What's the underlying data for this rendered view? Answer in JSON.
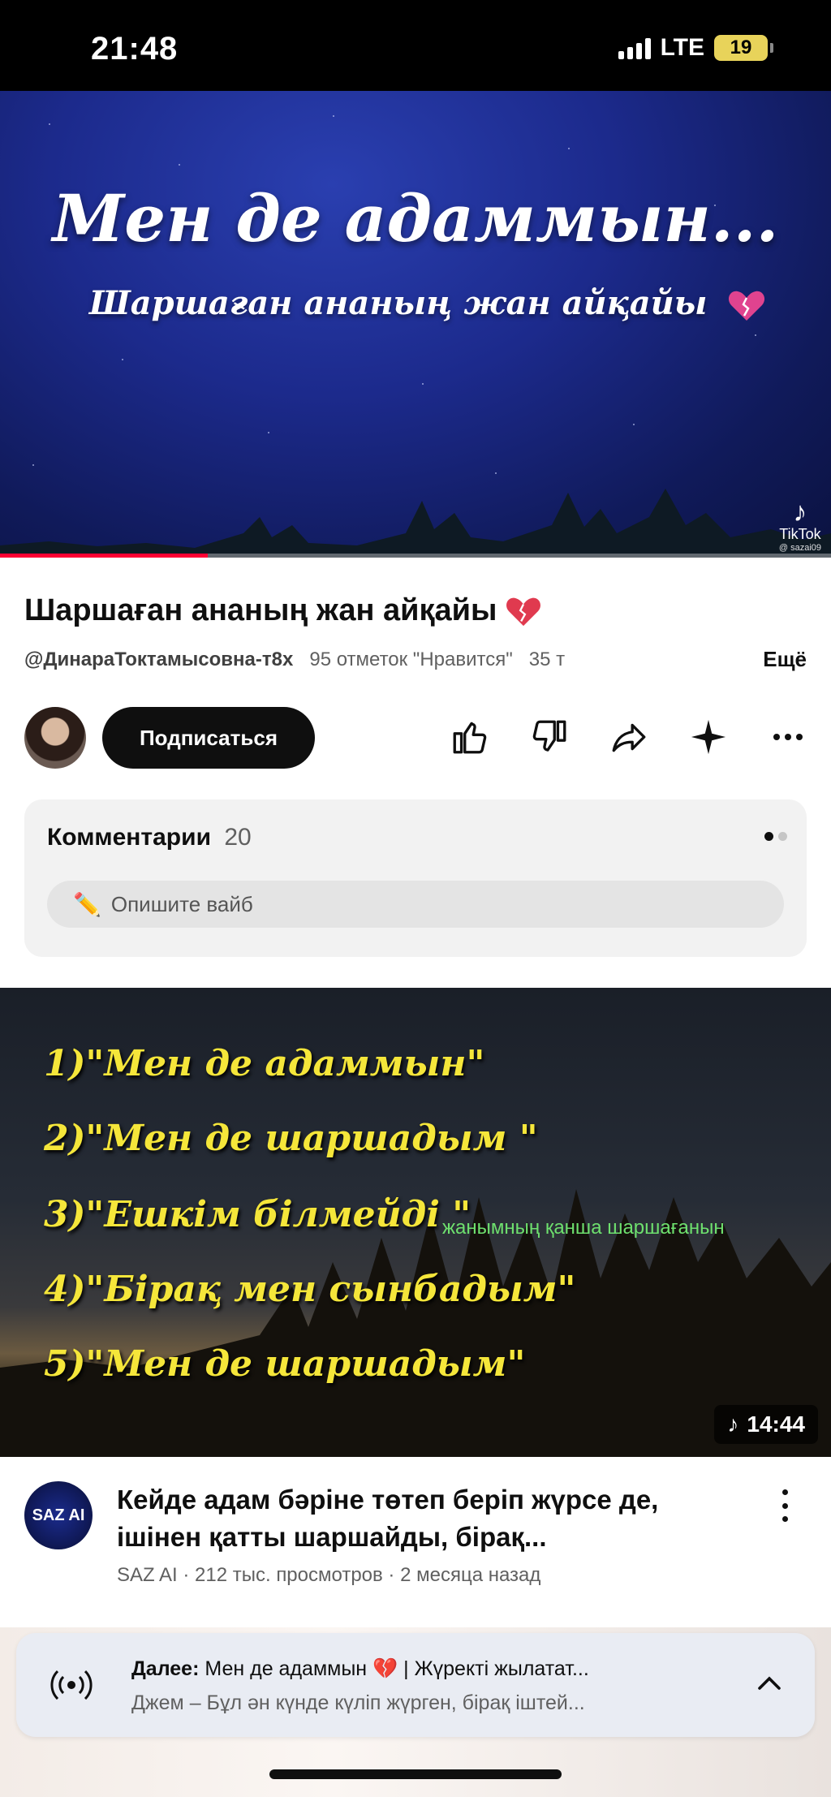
{
  "status_bar": {
    "time": "21:48",
    "network": "LTE",
    "battery": "19"
  },
  "hero": {
    "title": "Мен де адаммын...",
    "subtitle": "Шаршаған ананың жан айқайы",
    "watermark_logo": "TikTok",
    "watermark_user": "@ sazai09",
    "progress": 0.25
  },
  "video": {
    "title": "Шаршаған ананың жан айқайы",
    "channel": "@ДинараТоктамысовна-т8х",
    "likes": "95 отметок \"Нравится\"",
    "views_partial": "35 т",
    "more": "Ещё",
    "subscribe": "Подписаться"
  },
  "comments": {
    "label": "Комментарии",
    "count": "20",
    "placeholder": "Опишите вайб"
  },
  "video2": {
    "lyrics": [
      "1)\"Мен де адаммын\"",
      "2)\"Мен де шаршадым \"",
      "3)\"Ешкім білмейді \"",
      "4)\"Бірақ мен сынбадым\"",
      "5)\"Мен де шаршадым\""
    ],
    "side_caption": "жанымның қанша шаршағанын",
    "duration": "14:44",
    "title": "Кейде адам бәріне төтеп беріп жүрсе де, ішінен қатты шаршайды, бірақ...",
    "channel_logo": "SAZ AI",
    "meta": "SAZ AI · 212 тыс. просмотров · 2 месяца назад"
  },
  "next_up": {
    "label": "Далее:",
    "title": "Мен де адаммын 💔 | Жүректі жылатат...",
    "subtitle": "Джем – Бұл ән күнде күліп жүрген, бірақ іштей..."
  },
  "colors": {
    "accent_red": "#ff0033",
    "lyric_yellow": "#f5e63a",
    "caption_green": "#6ee06e"
  }
}
